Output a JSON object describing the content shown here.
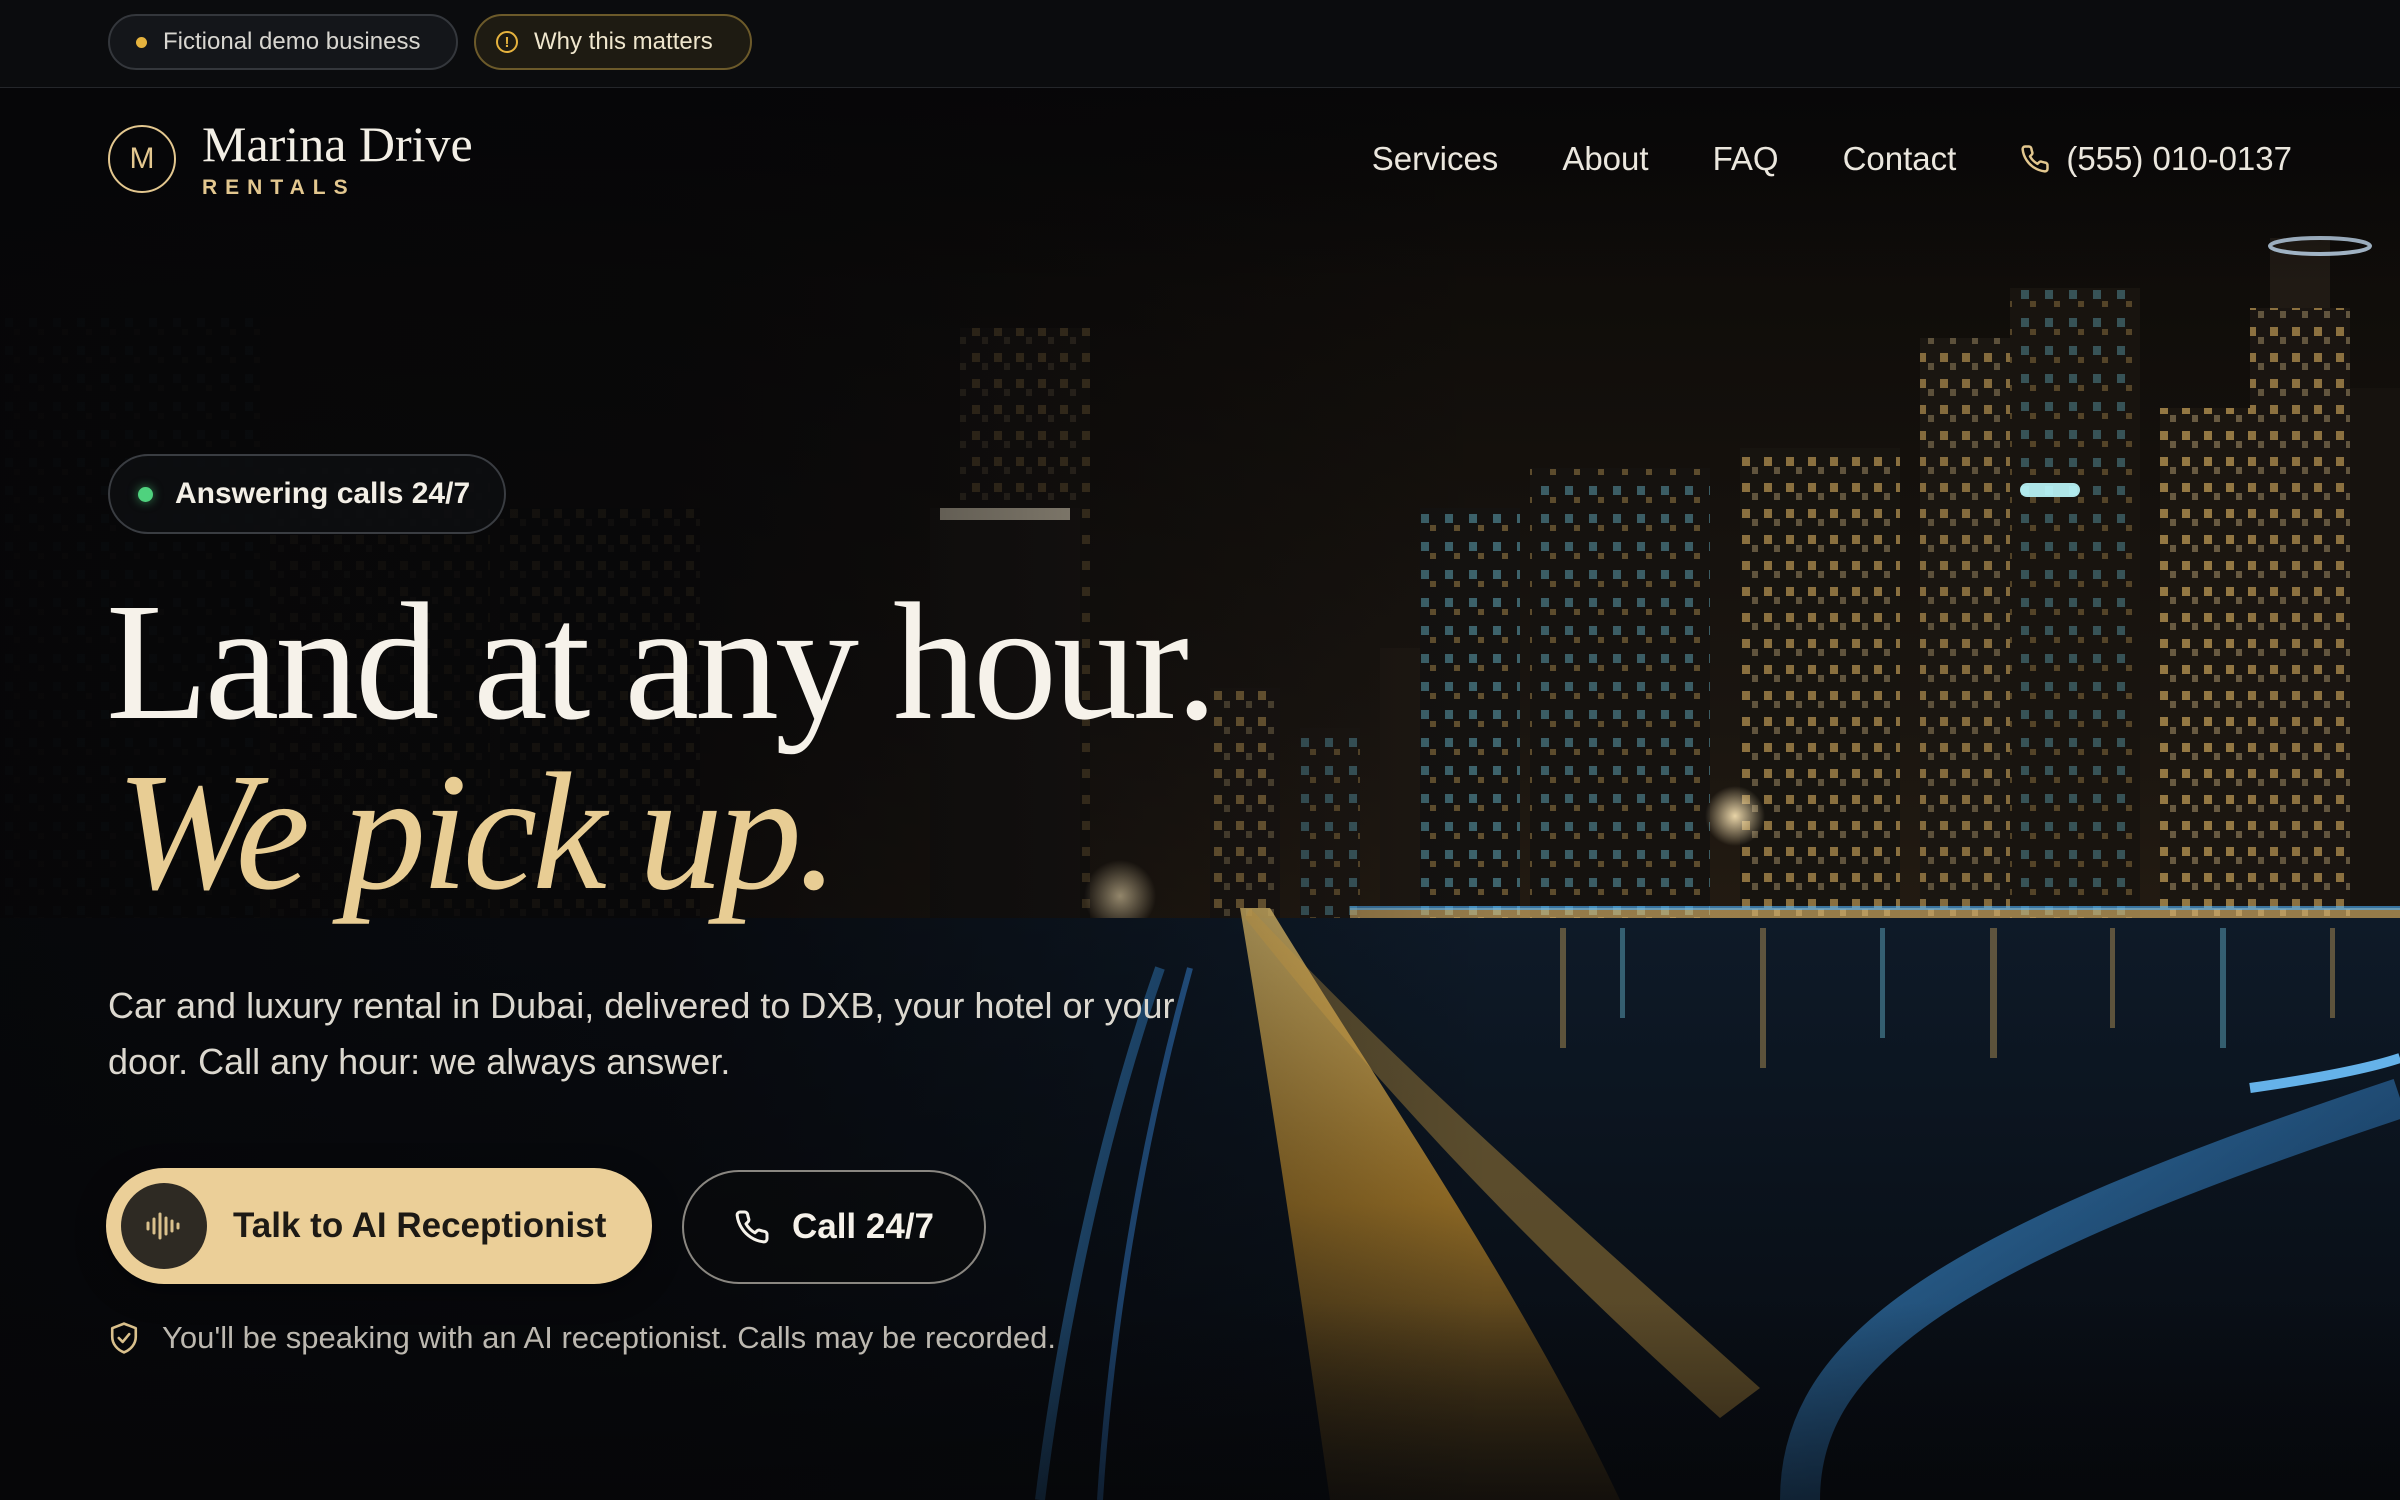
{
  "topbar": {
    "demo_label": "Fictional demo business",
    "why_label": "Why this matters"
  },
  "brand": {
    "monogram": "M",
    "name": "Marina Drive",
    "subtitle": "RENTALS"
  },
  "nav": {
    "items": [
      "Services",
      "About",
      "FAQ",
      "Contact"
    ],
    "phone": "(555) 010-0137"
  },
  "hero": {
    "status": "Answering calls 24/7",
    "headline_line1": "Land at any hour.",
    "headline_line2": "We pick up.",
    "subcopy": "Car and luxury rental in Dubai, delivered to DXB, your hotel or your door. Call any hour: we always answer.",
    "primary_cta": "Talk to AI Receptionist",
    "secondary_cta": "Call 24/7",
    "disclaimer": "You'll be speaking with an AI receptionist. Calls may be recorded."
  },
  "colors": {
    "accent_gold": "#e8cd94",
    "cta_gold": "#ebcf98",
    "status_green": "#4fd27e",
    "warning_amber": "#e6b33e"
  },
  "icons": {
    "demo_dot": "dot-icon",
    "why": "alert-circle-icon",
    "phone": "phone-icon",
    "voice": "voice-wave-icon",
    "disclaimer": "shield-check-icon"
  }
}
